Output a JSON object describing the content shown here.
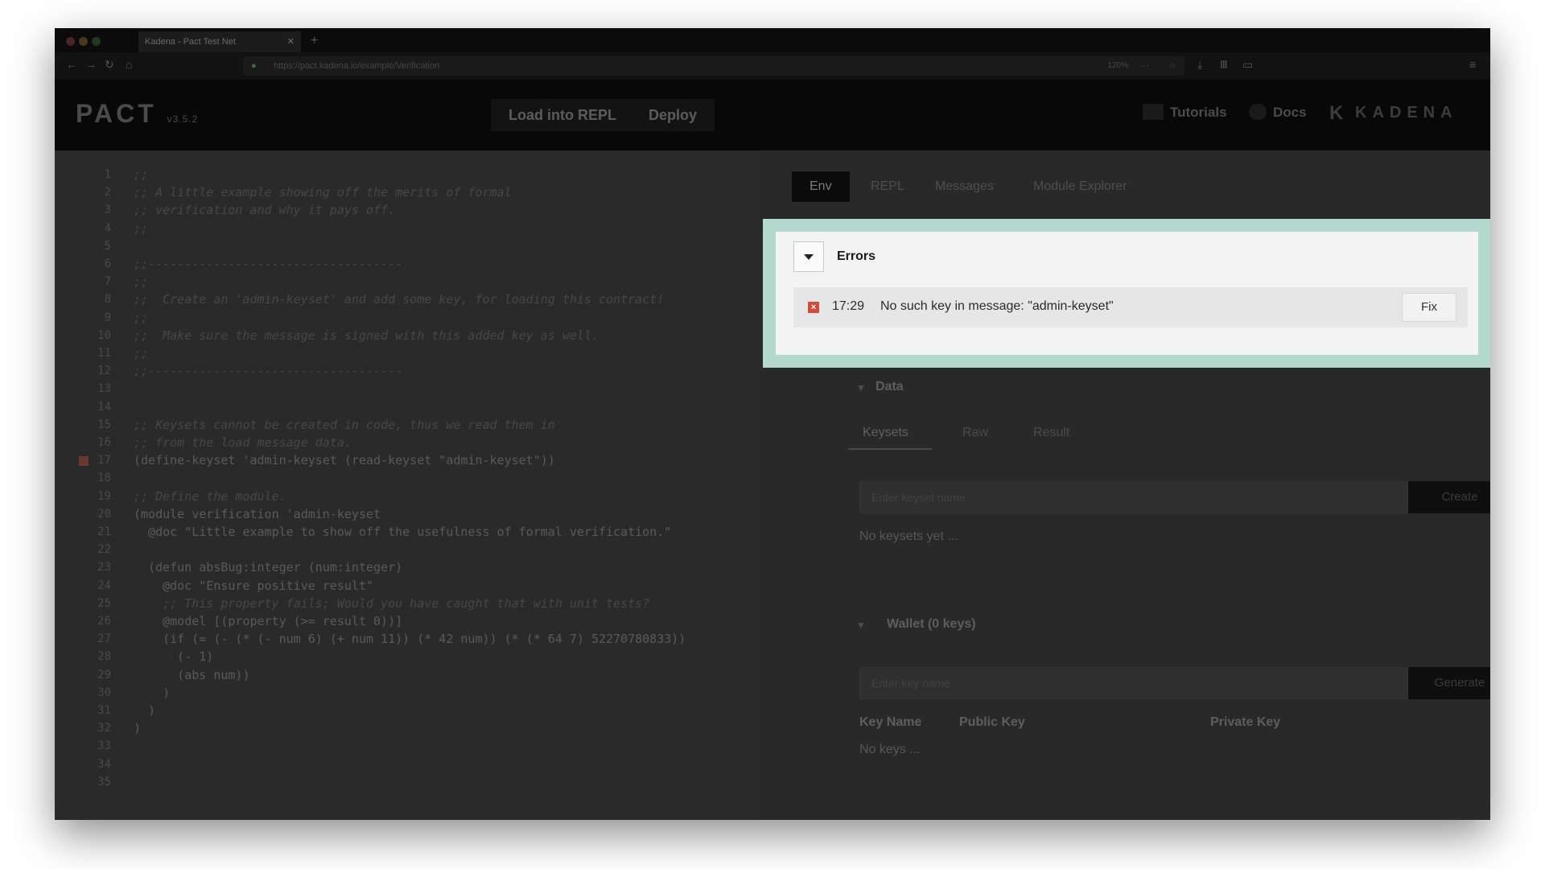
{
  "browser": {
    "tab_title": "Kadena - Pact Test Net",
    "tab_close": "✕",
    "new_tab": "+",
    "url": "https://pact.kadena.io/example/Verification",
    "zoom": "120%"
  },
  "header": {
    "logo": "PACT",
    "logo_sub": "v3.5.2",
    "load_repl": "Load into REPL",
    "deploy": "Deploy",
    "tutorials": "Tutorials",
    "docs": "Docs",
    "brand": "KADENA"
  },
  "editor": {
    "lines": [
      {
        "n": "1",
        "t": ";;",
        "c": "comment"
      },
      {
        "n": "2",
        "t": ";; A little example showing off the merits of formal",
        "c": "comment"
      },
      {
        "n": "3",
        "t": ";; verification and why it pays off.",
        "c": "comment"
      },
      {
        "n": "4",
        "t": ";;",
        "c": "comment"
      },
      {
        "n": "5",
        "t": "",
        "c": ""
      },
      {
        "n": "6",
        "t": ";;-----------------------------------",
        "c": "comment"
      },
      {
        "n": "7",
        "t": ";;",
        "c": "comment"
      },
      {
        "n": "8",
        "t": ";;  Create an 'admin-keyset' and add some key, for loading this contract!",
        "c": "comment"
      },
      {
        "n": "9",
        "t": ";;",
        "c": "comment"
      },
      {
        "n": "10",
        "t": ";;  Make sure the message is signed with this added key as well.",
        "c": "comment"
      },
      {
        "n": "11",
        "t": ";;",
        "c": "comment"
      },
      {
        "n": "12",
        "t": ";;-----------------------------------",
        "c": "comment"
      },
      {
        "n": "13",
        "t": "",
        "c": ""
      },
      {
        "n": "14",
        "t": "",
        "c": ""
      },
      {
        "n": "15",
        "t": ";; Keysets cannot be created in code, thus we read them in",
        "c": "comment"
      },
      {
        "n": "16",
        "t": ";; from the load message data.",
        "c": "comment"
      },
      {
        "n": "17",
        "t": "(define-keyset 'admin-keyset (read-keyset \"admin-keyset\"))",
        "c": "kw"
      },
      {
        "n": "18",
        "t": "",
        "c": ""
      },
      {
        "n": "19",
        "t": ";; Define the module.",
        "c": "comment"
      },
      {
        "n": "20",
        "t": "(module verification 'admin-keyset",
        "c": "kw"
      },
      {
        "n": "21",
        "t": "  @doc \"Little example to show off the usefulness of formal verification.\"",
        "c": "kw"
      },
      {
        "n": "22",
        "t": "",
        "c": ""
      },
      {
        "n": "23",
        "t": "  (defun absBug:integer (num:integer)",
        "c": "kw"
      },
      {
        "n": "24",
        "t": "    @doc \"Ensure positive result\"",
        "c": "kw"
      },
      {
        "n": "25",
        "t": "    ;; This property fails; Would you have caught that with unit tests?",
        "c": "comment"
      },
      {
        "n": "26",
        "t": "    @model [(property (>= result 0))]",
        "c": "kw"
      },
      {
        "n": "27",
        "t": "    (if (= (- (* (- num 6) (+ num 11)) (* 42 num)) (* (* 64 7) 52270780833))",
        "c": "kw"
      },
      {
        "n": "28",
        "t": "      (- 1)",
        "c": "kw"
      },
      {
        "n": "29",
        "t": "      (abs num))",
        "c": "kw"
      },
      {
        "n": "30",
        "t": "    )",
        "c": "kw"
      },
      {
        "n": "31",
        "t": "  )",
        "c": "kw"
      },
      {
        "n": "32",
        "t": ")",
        "c": "kw"
      },
      {
        "n": "33",
        "t": "",
        "c": ""
      },
      {
        "n": "34",
        "t": "",
        "c": ""
      },
      {
        "n": "35",
        "t": "",
        "c": ""
      }
    ]
  },
  "panel": {
    "tabs": [
      "Env",
      "REPL",
      "Messages",
      "Module Explorer"
    ],
    "errors": {
      "title": "Errors",
      "time": "17:29",
      "message": "No such key in message: \"admin-keyset\"",
      "fix": "Fix"
    },
    "data": {
      "title": "Data",
      "subtabs": [
        "Keysets",
        "Raw",
        "Result"
      ],
      "keyset_placeholder": "Enter keyset name",
      "create": "Create",
      "empty": "No keysets yet ..."
    },
    "wallet": {
      "title": "Wallet (0 keys)",
      "key_placeholder": "Enter key name",
      "generate": "Generate",
      "columns": [
        "Key Name",
        "Public Key",
        "Private Key"
      ],
      "empty": "No keys ..."
    }
  },
  "colors": {
    "highlight": "#b3d9cf",
    "error_icon": "#d14c3a"
  }
}
